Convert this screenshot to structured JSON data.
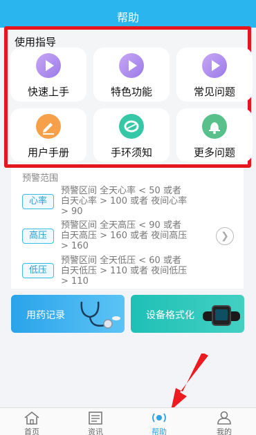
{
  "header": {
    "title": "帮助"
  },
  "guide": {
    "title": "使用指导",
    "tiles": [
      {
        "label": "快速上手",
        "icon": "play-icon"
      },
      {
        "label": "特色功能",
        "icon": "play-icon"
      },
      {
        "label": "常见问题",
        "icon": "play-icon"
      },
      {
        "label": "用户手册",
        "icon": "pen-icon"
      },
      {
        "label": "手环须知",
        "icon": "band-icon"
      },
      {
        "label": "更多问题",
        "icon": "bell-icon"
      }
    ]
  },
  "warning": {
    "title": "预警范围",
    "items": [
      {
        "badge": "心率",
        "line1": "预警区间  全天心率 < 50 或者",
        "line2": "白天心率 > 100 或者 夜间心率",
        "line3": "> 90"
      },
      {
        "badge": "高压",
        "line1": "预警区间  全天高压 < 90 或者",
        "line2": "白天高压 > 160 或者 夜间高压",
        "line3": "> 160"
      },
      {
        "badge": "低压",
        "line1": "预警区间  全天低压 < 60 或者",
        "line2": "白天低压 > 110 或者 夜间低压",
        "line3": "> 110"
      }
    ]
  },
  "banners": {
    "medication": "用药记录",
    "format": "设备格式化"
  },
  "tabs": [
    {
      "label": "首页",
      "icon": "home-icon"
    },
    {
      "label": "资讯",
      "icon": "news-icon"
    },
    {
      "label": "帮助",
      "icon": "help-icon",
      "active": true
    },
    {
      "label": "我的",
      "icon": "user-icon"
    }
  ],
  "colors": {
    "header": "#2bb5ee",
    "highlight_border": "#e5161d",
    "accent": "#2aa3ea"
  }
}
